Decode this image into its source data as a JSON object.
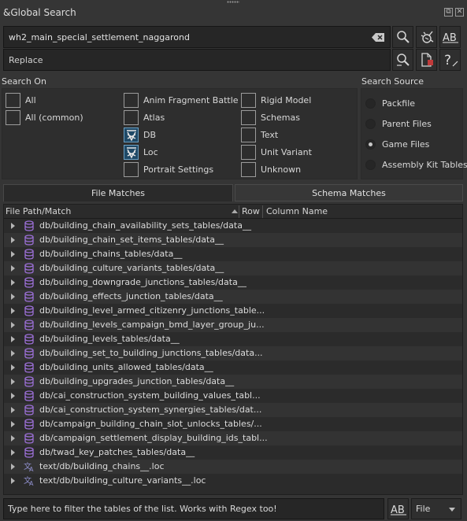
{
  "window": {
    "title": "&Global Search",
    "float_btn": "⧉",
    "close_btn": "✕"
  },
  "search": {
    "value": "wh2_main_special_settlement_naggarond",
    "replace_placeholder": "Replace"
  },
  "search_on": {
    "title": "Search On",
    "options": [
      {
        "label": "All",
        "checked": false
      },
      {
        "label": "All (common)",
        "checked": false
      },
      {
        "label": "Anim Fragment Battle",
        "checked": false
      },
      {
        "label": "Atlas",
        "checked": false
      },
      {
        "label": "DB",
        "checked": true
      },
      {
        "label": "Loc",
        "checked": true
      },
      {
        "label": "Portrait Settings",
        "checked": false
      },
      {
        "label": "Rigid Model",
        "checked": false
      },
      {
        "label": "Schemas",
        "checked": false
      },
      {
        "label": "Text",
        "checked": false
      },
      {
        "label": "Unit Variant",
        "checked": false
      },
      {
        "label": "Unknown",
        "checked": false
      }
    ]
  },
  "search_source": {
    "title": "Search Source",
    "options": [
      {
        "label": "Packfile",
        "selected": false
      },
      {
        "label": "Parent Files",
        "selected": false
      },
      {
        "label": "Game Files",
        "selected": true
      },
      {
        "label": "Assembly Kit Tables",
        "selected": false
      }
    ]
  },
  "tabs": [
    {
      "label": "File Matches",
      "active": true
    },
    {
      "label": "Schema Matches",
      "active": false
    }
  ],
  "table": {
    "columns": [
      "File Path/Match",
      "Row",
      "Column Name"
    ],
    "rows": [
      {
        "type": "db",
        "path": "db/building_chain_availability_sets_tables/data__"
      },
      {
        "type": "db",
        "path": "db/building_chain_set_items_tables/data__"
      },
      {
        "type": "db",
        "path": "db/building_chains_tables/data__"
      },
      {
        "type": "db",
        "path": "db/building_culture_variants_tables/data__"
      },
      {
        "type": "db",
        "path": "db/building_downgrade_junctions_tables/data__"
      },
      {
        "type": "db",
        "path": "db/building_effects_junction_tables/data__"
      },
      {
        "type": "db",
        "path": "db/building_level_armed_citizenry_junctions_table..."
      },
      {
        "type": "db",
        "path": "db/building_levels_campaign_bmd_layer_group_ju..."
      },
      {
        "type": "db",
        "path": "db/building_levels_tables/data__"
      },
      {
        "type": "db",
        "path": "db/building_set_to_building_junctions_tables/data..."
      },
      {
        "type": "db",
        "path": "db/building_units_allowed_tables/data__"
      },
      {
        "type": "db",
        "path": "db/building_upgrades_junction_tables/data__"
      },
      {
        "type": "db",
        "path": "db/cai_construction_system_building_values_tabl..."
      },
      {
        "type": "db",
        "path": "db/cai_construction_system_synergies_tables/dat..."
      },
      {
        "type": "db",
        "path": "db/campaign_building_chain_slot_unlocks_tables/..."
      },
      {
        "type": "db",
        "path": "db/campaign_settlement_display_building_ids_tabl..."
      },
      {
        "type": "db",
        "path": "db/twad_key_patches_tables/data__"
      },
      {
        "type": "loc",
        "path": "text/db/building_chains__.loc"
      },
      {
        "type": "loc",
        "path": "text/db/building_culture_variants__.loc"
      }
    ]
  },
  "filter": {
    "placeholder": "Type here to filter the tables of the list. Works with Regex too!",
    "case_label": "AB",
    "column_value": "File"
  },
  "colors": {
    "db_icon": "#9b6fd6",
    "loc_icon": "#8c8cc8",
    "checked_bg": "#1f4966"
  }
}
